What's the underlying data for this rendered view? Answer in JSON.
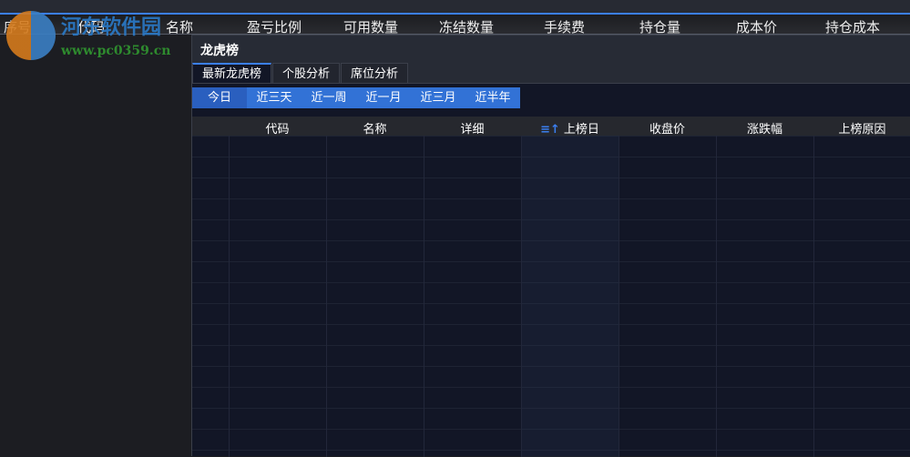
{
  "header": {
    "columns": [
      "序号",
      "代码",
      "名称",
      "盈亏比例",
      "可用数量",
      "冻结数量",
      "手续费",
      "持仓量",
      "成本价",
      "持仓成本"
    ]
  },
  "watermark": {
    "name": "河东软件园",
    "url": "www.pc0359.cn"
  },
  "panel": {
    "title": "龙虎榜",
    "tabs": [
      {
        "label": "最新龙虎榜",
        "active": true
      },
      {
        "label": "个股分析"
      },
      {
        "label": "席位分析"
      }
    ],
    "ranges": [
      {
        "label": "今日",
        "active": true
      },
      {
        "label": "近三天"
      },
      {
        "label": "近一周"
      },
      {
        "label": "近一月"
      },
      {
        "label": "近三月"
      },
      {
        "label": "近半年"
      }
    ],
    "table": {
      "columns": [
        "代码",
        "名称",
        "详细",
        "上榜日",
        "收盘价",
        "涨跌幅",
        "上榜原因"
      ],
      "sorted_column": "上榜日",
      "rows": []
    }
  },
  "colors": {
    "accent": "#3b7ff0",
    "range_bar": "#3272d6"
  }
}
